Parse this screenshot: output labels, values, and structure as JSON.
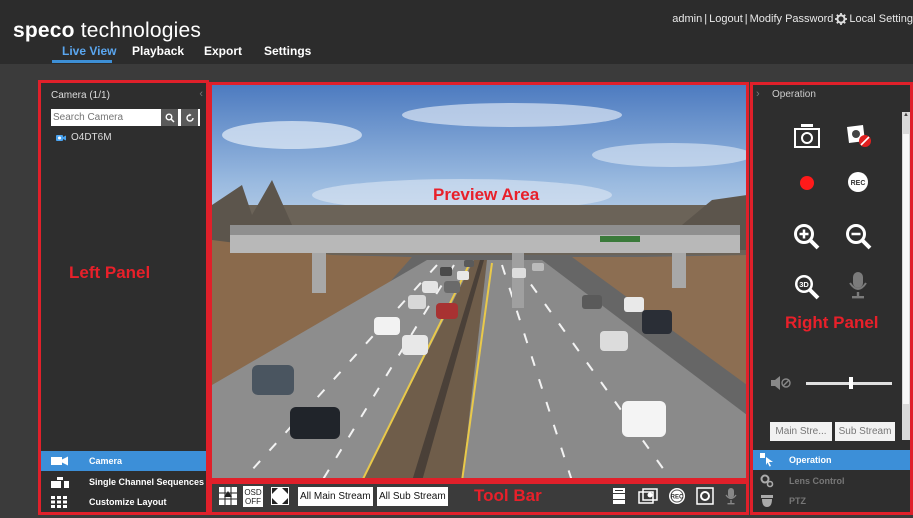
{
  "header": {
    "logo_bold": "speco",
    "logo_rest": " technologies",
    "nav": [
      "Live View",
      "Playback",
      "Export",
      "Settings"
    ],
    "active_nav": "Live View",
    "user": "admin",
    "sep1": " | ",
    "logout": "Logout",
    "sep2": " | ",
    "modify_password": "Modify Password",
    "local_settings": "Local Setting"
  },
  "left_panel": {
    "title": "Camera (1/1)",
    "search_placeholder": "Search Camera",
    "camera_name": "O4DT6M",
    "bottom_items": [
      "Camera",
      "Single Channel Sequences",
      "Customize Layout"
    ],
    "active_bottom": "Camera"
  },
  "toolbar": {
    "osd_top": "OSD",
    "osd_bottom": "OFF",
    "main_stream": "All Main Stream",
    "sub_stream": "All Sub Stream"
  },
  "right_panel": {
    "title": "Operation",
    "rec_label": "REC",
    "zoom3d_label": "3D",
    "main_stream": "Main Stre...",
    "sub_stream": "Sub Stream",
    "bottom_items": [
      "Operation",
      "Lens Control",
      "PTZ"
    ],
    "active_bottom": "Operation"
  },
  "annotations": {
    "left": "Left Panel",
    "preview": "Preview Area",
    "right": "Right Panel",
    "toolbar": "Tool Bar"
  },
  "colors": {
    "accent": "#3d8fd6",
    "annotation": "#e0202a",
    "record": "#ff1a1a"
  },
  "icons": [
    "search-icon",
    "refresh-icon",
    "camera-icon",
    "snapshot-icon",
    "disable-audio-icon",
    "record-icon",
    "rec-icon",
    "zoom-in-icon",
    "zoom-out-icon",
    "zoom-3d-icon",
    "microphone-icon",
    "speaker-icon",
    "layout-icon",
    "sequence-icon",
    "grid-icon",
    "fullscreen-icon",
    "gear-icon"
  ]
}
